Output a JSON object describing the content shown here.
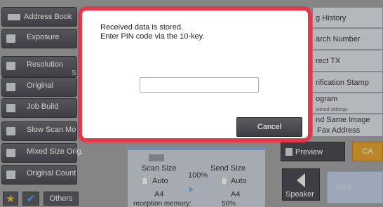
{
  "left_menu": {
    "address_book": "Address Book",
    "exposure": "Exposure",
    "resolution": "Resolution",
    "resolution_sub": "S",
    "original": "Original",
    "job_build": "Job Build",
    "slow_scan": "Slow Scan Mo",
    "mixed_size": "Mixed Size Orig.",
    "original_count": "Original Count",
    "others": "Others"
  },
  "right_menu": {
    "sending_history": "g History",
    "search_number": "arch Number",
    "direct_tx": "rect TX",
    "verification_stamp": "rification Stamp",
    "program": "ogram",
    "program_sub": "stered settings",
    "send_same_image_1": "nd Same Image",
    "send_same_image_2": "Fax Address"
  },
  "center": {
    "scan_size_label": "Scan Size",
    "send_size_label": "Send Size",
    "ratio": "100%",
    "scan_auto": "Auto",
    "send_auto": "Auto",
    "scan_a4": "A4",
    "send_a4": "A4",
    "memory_label": "reception memory:",
    "memory_value": "50%"
  },
  "actions": {
    "preview": "Preview",
    "ca": "CA",
    "speaker": "Speaker",
    "start": "Start"
  },
  "dialog": {
    "line1": "Received data is stored.",
    "line2": "Enter PIN code via the 10-key.",
    "pin_value": "",
    "cancel": "Cancel"
  },
  "colors": {
    "dialog_border": "#e0394c",
    "ca_button": "#e39a1e",
    "accent_blue": "#3aa6e8"
  },
  "icons": [
    "address-book-icon",
    "exposure-icon",
    "resolution-icon",
    "original-icon",
    "job-build-icon",
    "slow-scan-icon",
    "mixed-size-icon",
    "original-count-icon",
    "star-icon",
    "check-icon",
    "preview-icon",
    "speaker-icon",
    "start-icon"
  ]
}
